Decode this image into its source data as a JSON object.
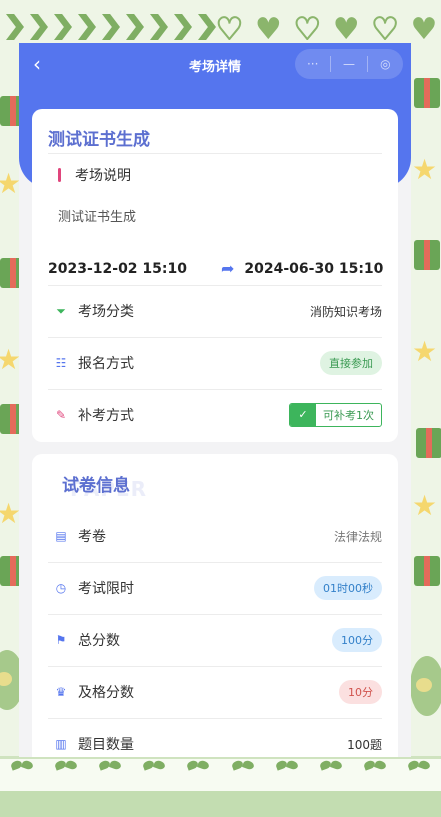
{
  "header": {
    "title": "考场详情",
    "back_icon": "chevron-left-icon",
    "capsule": [
      "···",
      "—",
      "◎"
    ]
  },
  "exam": {
    "name": "测试证书生成",
    "section_label": "考场说明",
    "description": "测试证书生成",
    "start_time": "2023-12-02 15:10",
    "end_time": "2024-06-30 15:10",
    "rows": [
      {
        "icon": "filter-icon",
        "label": "考场分类",
        "value": "消防知识考场",
        "style": "plain"
      },
      {
        "icon": "list-icon",
        "label": "报名方式",
        "value": "直接参加",
        "style": "pill-green"
      },
      {
        "icon": "pencil-icon",
        "label": "补考方式",
        "value": "可补考1次",
        "style": "checkbox"
      }
    ]
  },
  "paper": {
    "title": "试卷信息",
    "watermark": "PAPER",
    "rows": [
      {
        "icon": "document-icon",
        "label": "考卷",
        "value": "法律法规",
        "style": "grey"
      },
      {
        "icon": "clock-icon",
        "label": "考试限时",
        "value": "01时00秒",
        "style": "pill-blue"
      },
      {
        "icon": "flag-icon",
        "label": "总分数",
        "value": "100分",
        "style": "pill-blue"
      },
      {
        "icon": "trophy-icon",
        "label": "及格分数",
        "value": "10分",
        "style": "pill-red"
      },
      {
        "icon": "barcode-icon",
        "label": "题目数量",
        "value": "100题",
        "style": "plain"
      }
    ]
  },
  "colors": {
    "primary": "#5575ee",
    "title": "#5c6fd0",
    "accent_pink": "#e0457c",
    "green": "#3db55c"
  }
}
